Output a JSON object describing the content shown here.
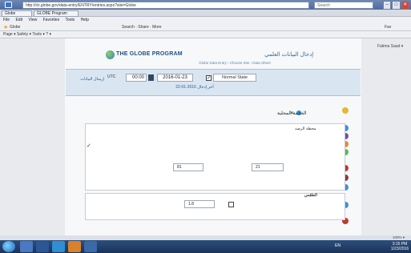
{
  "browser": {
    "address": "http://ict.globe.gov/data-entry/ENTRY/entries.aspx?site=Globe",
    "search_text": "Search",
    "window_buttons": [
      "–",
      "□",
      "✕"
    ],
    "tabs": [
      "Globe",
      "GLOBE Program"
    ],
    "menu": [
      "File",
      "Edit",
      "View",
      "Favorites",
      "Tools",
      "Help"
    ],
    "favorites_label": "Globe",
    "favbar_mid": "Search · Share · More",
    "favbar_right": "Fav",
    "commandbar": "Page ▾ Safety ▾ Tools ▾ ? ▾"
  },
  "page": {
    "top_right": "Fatima Saad ▾",
    "logo_text": "THE GLOBE PROGRAM",
    "arabic_title": "إدخال البيانات العلمي",
    "breadcrumb": "Globe Data Entry › Choose Site › Data Sheet",
    "header_note": "",
    "select_label": "إرسال البيانات",
    "time_unit": "UTC",
    "time_value": "00:00",
    "date_value": "2016-01-23",
    "state_value": "Normal State",
    "date_line": "آخر إدخال 2016-01-22"
  },
  "section": {
    "title": "",
    "group_label": "الخدمة المحلية",
    "card1": {
      "head": "محطة الرصد",
      "sub": "",
      "check": "✓",
      "q1": "",
      "q2": "",
      "q3": "",
      "q4": "",
      "field1": "21",
      "field2": "81"
    },
    "card2": {
      "head": "الطقس",
      "sub": "",
      "field": "1.8"
    }
  },
  "status": {
    "text": "100% ▾"
  },
  "taskbar": {
    "tray": "EN",
    "time": "3:15 PM",
    "date": "1/23/2016"
  }
}
